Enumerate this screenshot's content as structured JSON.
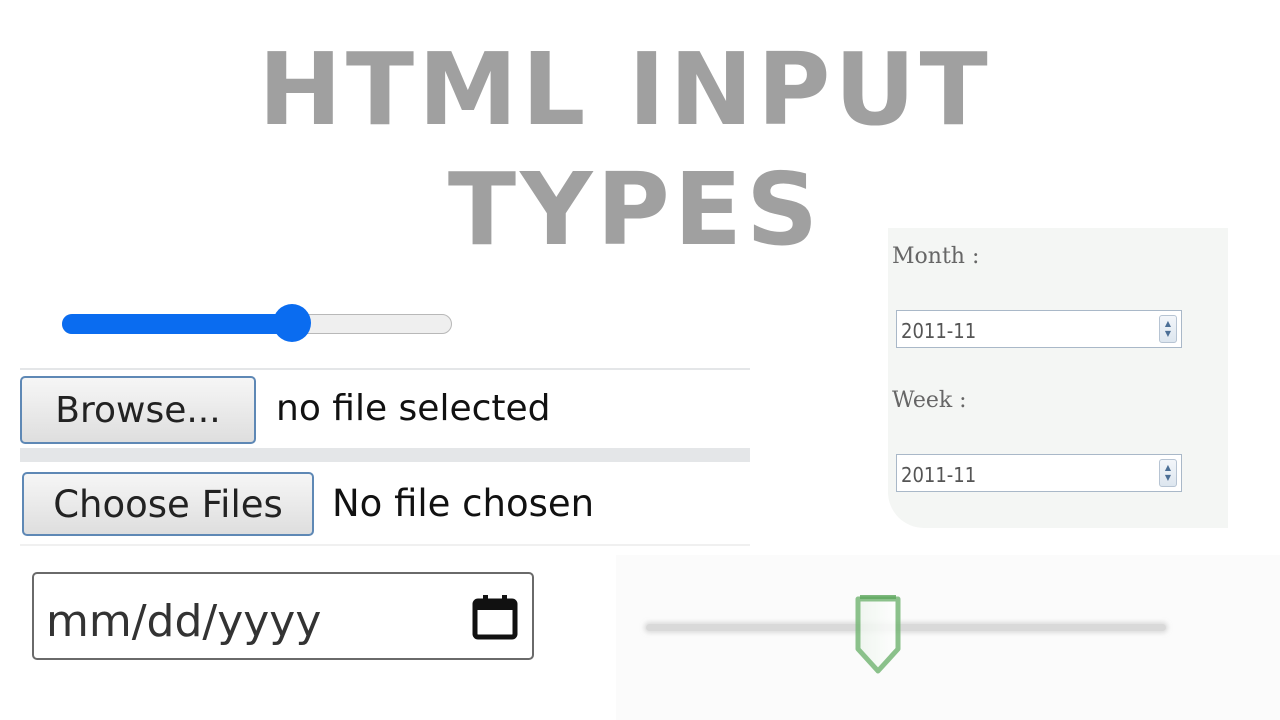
{
  "title": {
    "line1": "HTML INPUT",
    "line2": "TYPES"
  },
  "range": {
    "value": 0.59
  },
  "file_input_1": {
    "button_label": "Browse...",
    "status": "no file selected"
  },
  "file_input_2": {
    "button_label": "Choose Files",
    "status": "No file chosen"
  },
  "date_input": {
    "placeholder": "mm/dd/yyyy",
    "icon": "calendar-icon"
  },
  "month_week": {
    "month_label": "Month :",
    "month_value": "2011-11",
    "week_label": "Week :",
    "week_value": "2011-11"
  },
  "green_range": {
    "value": 0.46
  },
  "colors": {
    "title": "#a0a0a0",
    "range_accent": "#0a6cf0",
    "button_border": "#5e88b5",
    "green_thumb": "#6aa86a"
  }
}
